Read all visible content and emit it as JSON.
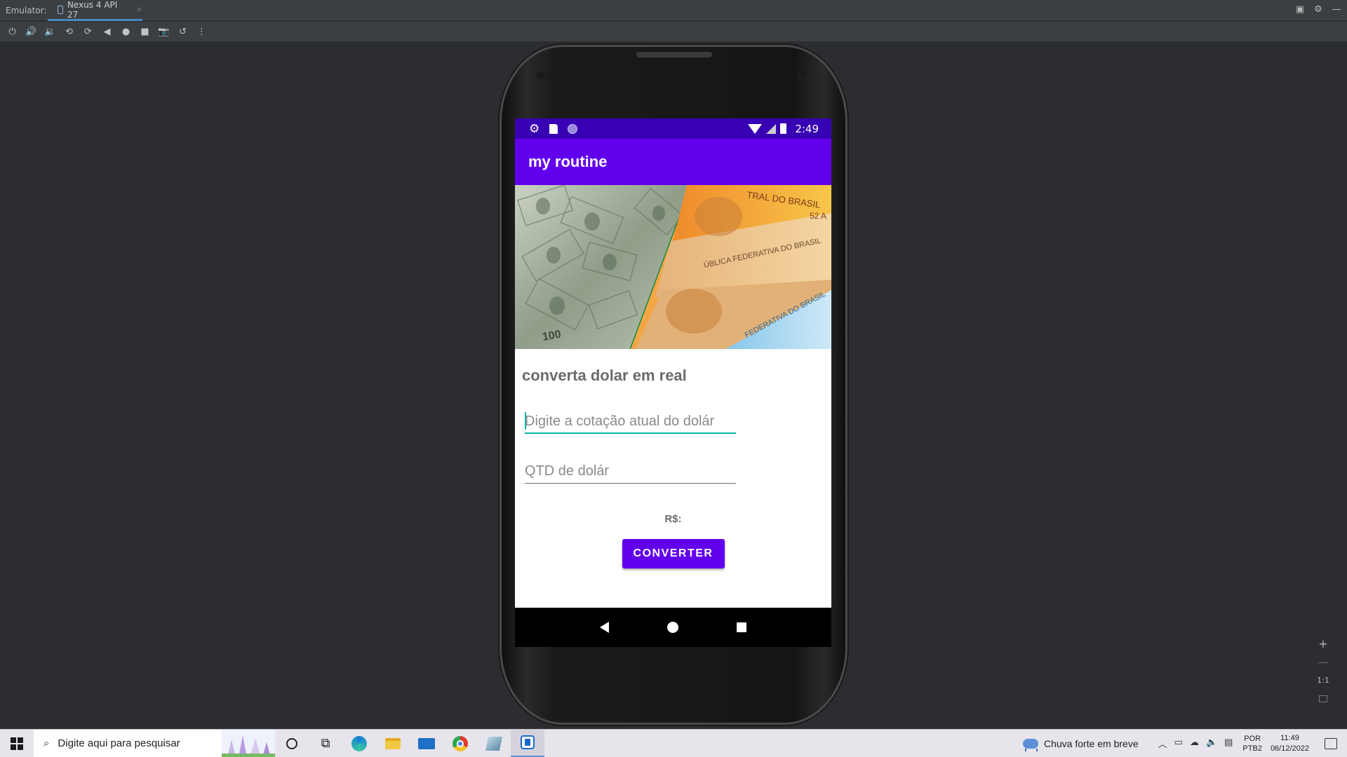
{
  "ide": {
    "emulator_label": "Emulator:",
    "device_tab": "Nexus 4 API 27",
    "tab_close": "×"
  },
  "toolbar_icons": [
    "power-icon",
    "volume-up-icon",
    "volume-down-icon",
    "rotate-left-icon",
    "rotate-right-icon",
    "back-icon",
    "home-icon",
    "overview-icon",
    "screenshot-icon",
    "snapshot-icon",
    "more-icon"
  ],
  "phone": {
    "status_bar": {
      "time": "2:49",
      "color": "#3700b3"
    },
    "app_bar": {
      "title": "my routine",
      "color": "#6200ee"
    },
    "hero_image": {
      "left_side": "dollar-banknotes",
      "right_side": "real-banknotes",
      "left_text": "100",
      "right_text_1": "TRAL DO BRASIL",
      "right_text_2": "ÚBLICA FEDERATIVA DO BRASIL",
      "right_text_3": "FEDERATIVA DO BRASIL",
      "right_text_4": "52 A"
    },
    "heading": "converta dolar em real",
    "rate_input": {
      "value": "",
      "placeholder": "Digite a cotação atual do dolár"
    },
    "amount_input": {
      "value": "",
      "placeholder": "QTD de dolár"
    },
    "result_label": "R$:",
    "convert_button": "CONVERTER",
    "accent_color": "#03b5a5"
  },
  "zoom": {
    "zoom_in": "+",
    "zoom_out": "—",
    "actual_size": "1:1"
  },
  "taskbar": {
    "search_placeholder": "Digite aqui para pesquisar",
    "weather": "Chuva forte em breve",
    "lang_line1": "POR",
    "lang_line2": "PTB2",
    "time": "11:49",
    "date": "06/12/2022"
  }
}
